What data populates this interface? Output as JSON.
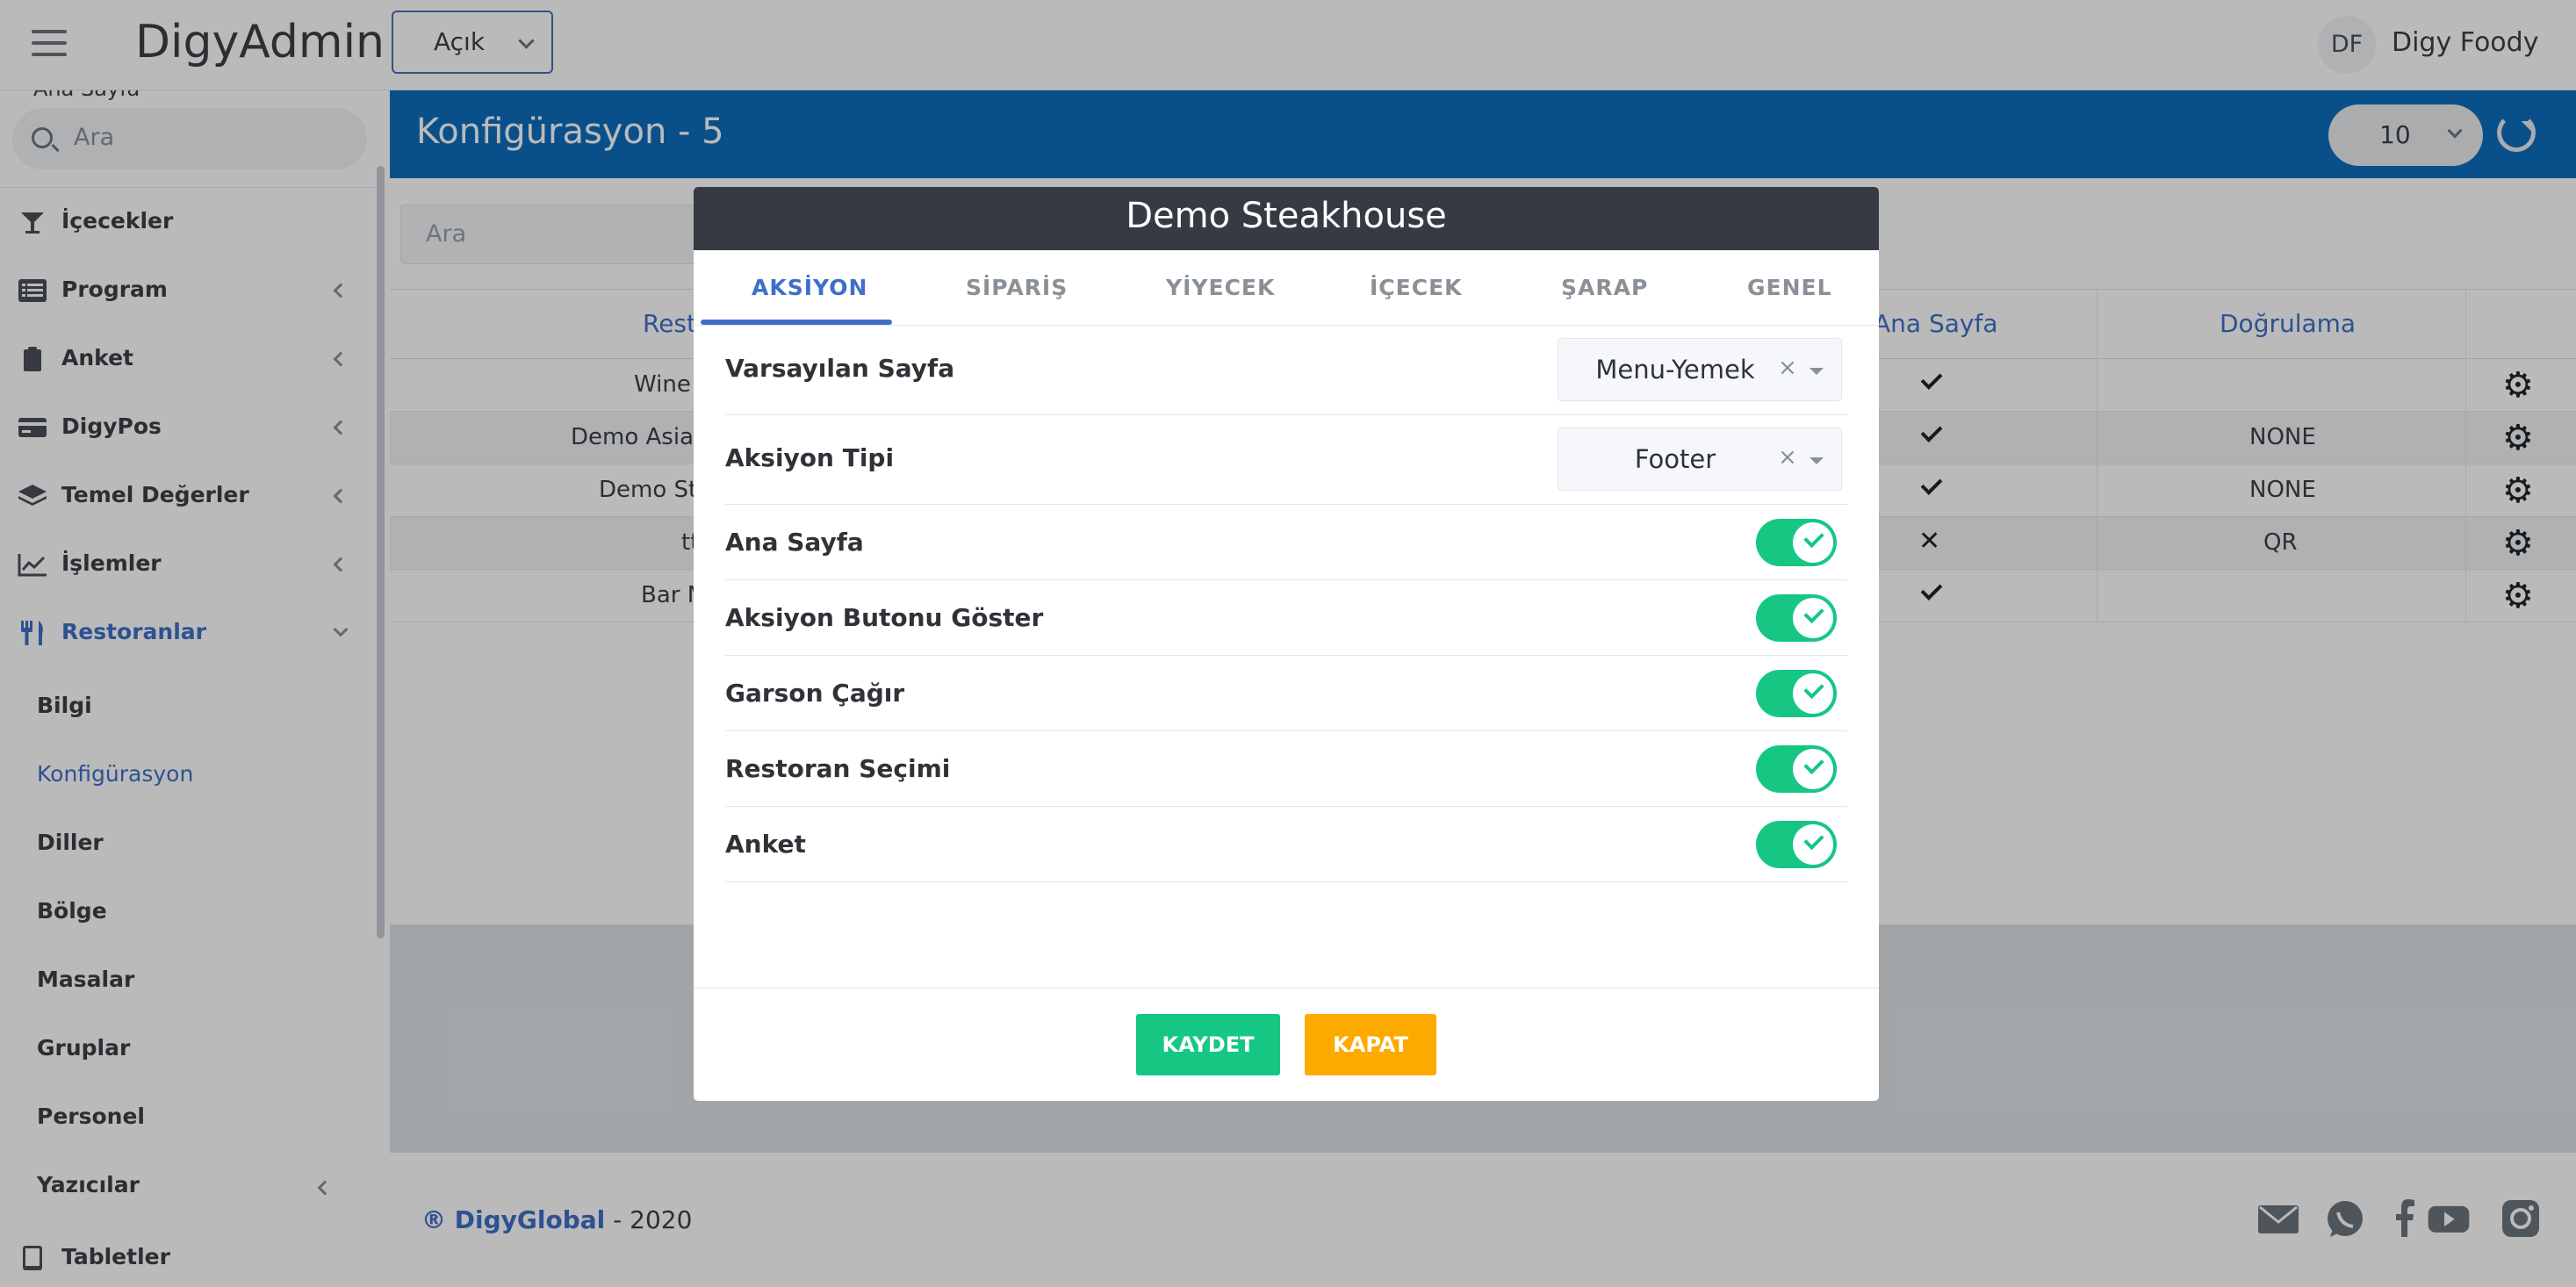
{
  "topbar": {
    "brand": "DigyAdmin",
    "status_value": "Açık",
    "user_initials": "DF",
    "user_name": "Digy Foody"
  },
  "sidebar": {
    "cut_item": "Ana Sayfa",
    "search_placeholder": "Ara",
    "items": [
      {
        "label": "İçecekler"
      },
      {
        "label": "Program"
      },
      {
        "label": "Anket"
      },
      {
        "label": "DigyPos"
      },
      {
        "label": "Temel Değerler"
      },
      {
        "label": "İşlemler"
      },
      {
        "label": "Restoranlar"
      }
    ],
    "subitems": [
      {
        "label": "Bilgi"
      },
      {
        "label": "Konfigürasyon"
      },
      {
        "label": "Diller"
      },
      {
        "label": "Bölge"
      },
      {
        "label": "Masalar"
      },
      {
        "label": "Gruplar"
      },
      {
        "label": "Personel"
      },
      {
        "label": "Yazıcılar"
      }
    ],
    "last_item": "Tabletler"
  },
  "page": {
    "title": "Konfigürasyon - 5",
    "page_size": "10",
    "search_placeholder": "Ara",
    "columns": {
      "restaurant": "Rest",
      "home": "Ana Sayfa",
      "validation": "Doğrulama"
    },
    "rows": [
      {
        "name": "Wine",
        "validation": ""
      },
      {
        "name": "Demo Asian",
        "validation": "NONE"
      },
      {
        "name": "Demo Ste",
        "validation": "NONE"
      },
      {
        "name": "tt",
        "validation": "QR"
      },
      {
        "name": "Bar M",
        "validation": ""
      }
    ]
  },
  "footer": {
    "brand": "® DigyGlobal",
    "year_text": " - 2020"
  },
  "modal": {
    "title": "Demo Steakhouse",
    "tabs": [
      "AKSİYON",
      "SİPARİŞ",
      "YİYECEK",
      "İÇECEK",
      "ŞARAP",
      "GENEL"
    ],
    "active_tab": "AKSİYON",
    "selects": [
      {
        "label": "Varsayılan Sayfa",
        "value": "Menu-Yemek"
      },
      {
        "label": "Aksiyon Tipi",
        "value": "Footer"
      }
    ],
    "toggles": [
      {
        "label": "Ana Sayfa",
        "on": true
      },
      {
        "label": "Aksiyon Butonu Göster",
        "on": true
      },
      {
        "label": "Garson Çağır",
        "on": true
      },
      {
        "label": "Restoran Seçimi",
        "on": true
      },
      {
        "label": "Anket",
        "on": true
      }
    ],
    "save_label": "KAYDET",
    "close_label": "KAPAT"
  },
  "colors": {
    "primary": "#0d6ebd",
    "accent": "#3f6fc8",
    "success": "#16c784",
    "warning": "#fdaa00",
    "modal_header": "#363b43"
  }
}
